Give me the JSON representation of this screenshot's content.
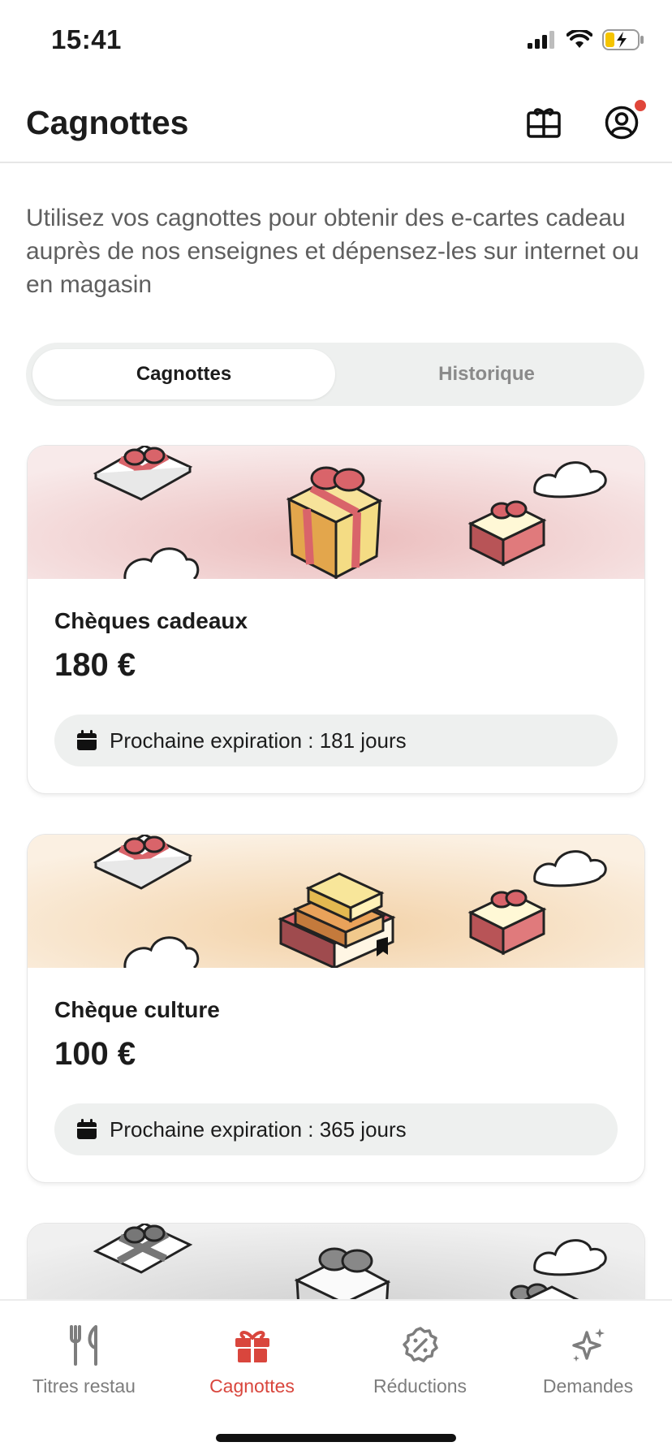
{
  "status_bar": {
    "time": "15:41"
  },
  "header": {
    "title": "Cagnottes"
  },
  "intro_text": "Utilisez vos cagnottes pour obtenir des e-cartes cadeau auprès de nos enseignes et dépensez-les sur internet ou en magasin",
  "tabs": {
    "active": "Cagnottes",
    "inactive": "Historique"
  },
  "cards": [
    {
      "title": "Chèques cadeaux",
      "amount": "180 €",
      "expiry": "Prochaine expiration : 181 jours",
      "banner_color": "#f0cfcf"
    },
    {
      "title": "Chèque culture",
      "amount": "100 €",
      "expiry": "Prochaine expiration : 365 jours",
      "banner_color": "#f8e3c8"
    }
  ],
  "bottom_nav": [
    {
      "label": "Titres restau",
      "icon": "fork-knife-icon"
    },
    {
      "label": "Cagnottes",
      "icon": "gift-icon"
    },
    {
      "label": "Réductions",
      "icon": "discount-badge-icon"
    },
    {
      "label": "Demandes",
      "icon": "sparkles-icon"
    }
  ],
  "colors": {
    "accent": "#d9463d",
    "text": "#1c1c1c",
    "muted": "#7d7d7d",
    "pill": "#eef0ef"
  }
}
